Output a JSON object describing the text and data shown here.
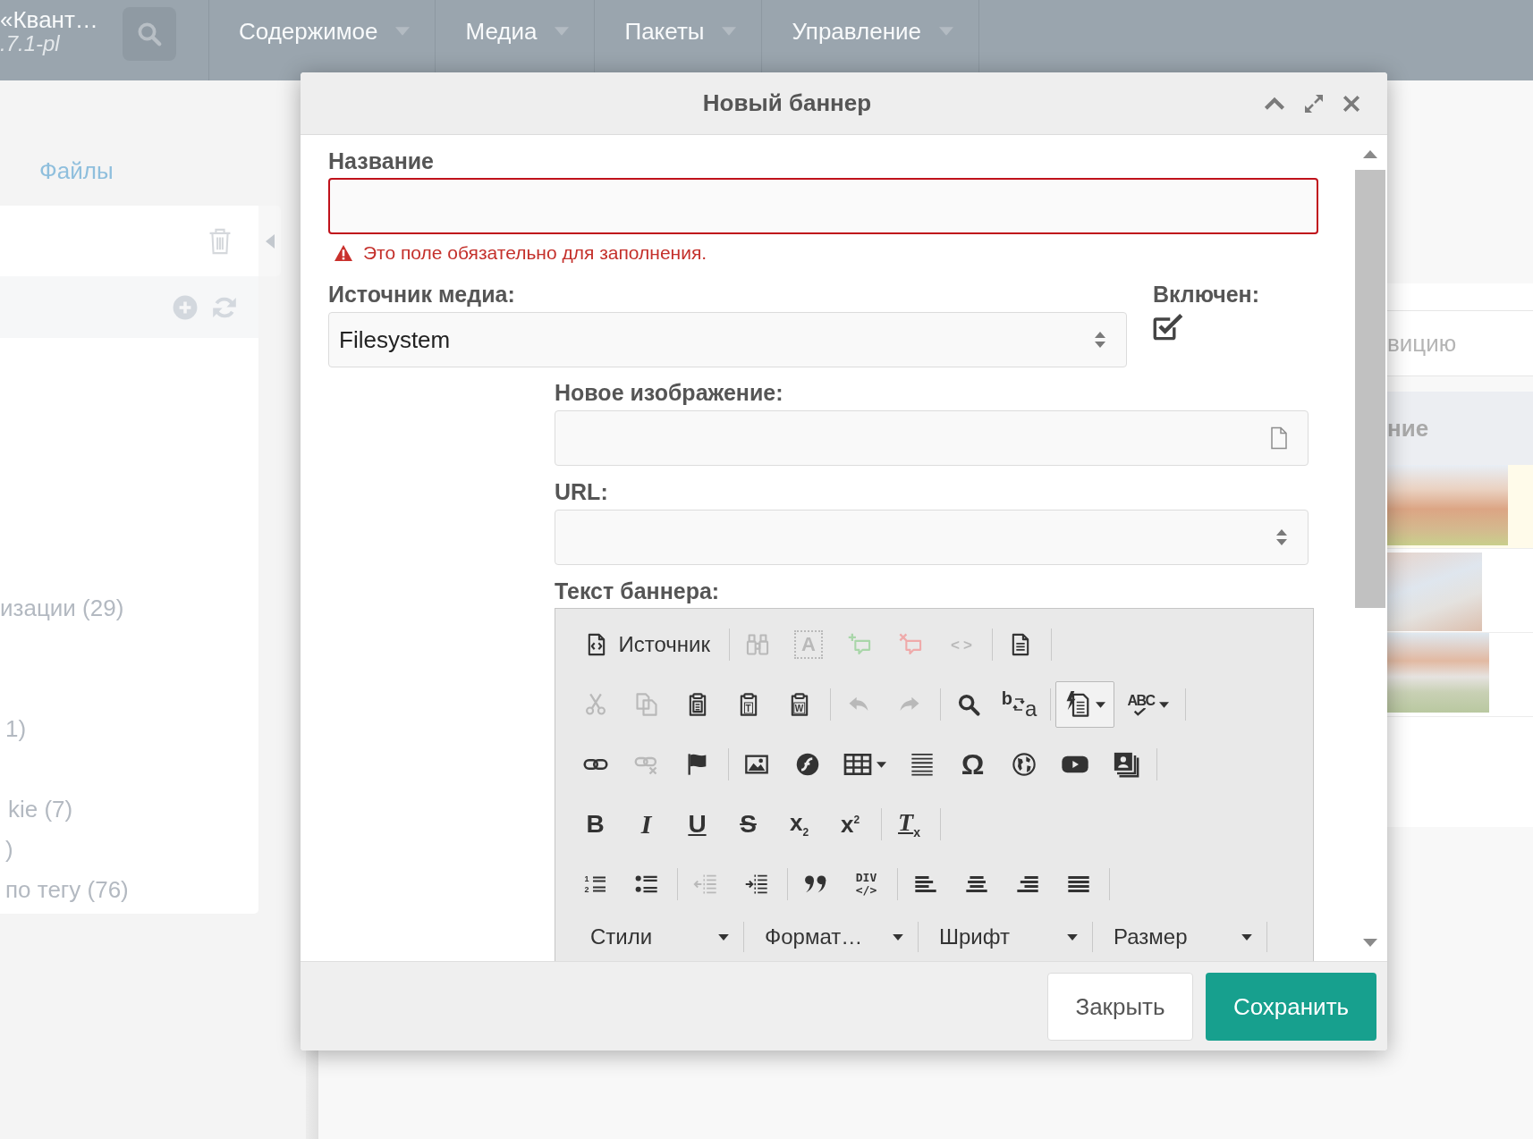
{
  "topbar": {
    "site_name": "«Квант…",
    "version": ".7.1-pl",
    "menu": [
      {
        "label": "Содержимое"
      },
      {
        "label": "Медиа"
      },
      {
        "label": "Пакеты"
      },
      {
        "label": "Управление"
      }
    ]
  },
  "sidebar": {
    "tab": "Файлы",
    "items": [
      {
        "label": "изации (29)"
      },
      {
        "label": "1)"
      },
      {
        "label": "kie (7)"
      },
      {
        "label": ")"
      },
      {
        "label": "по тегу (76)"
      }
    ]
  },
  "right_panel": {
    "row_text": "вицию",
    "heading": "ние",
    "image_rows": [
      {
        "highlighted": true
      },
      {
        "highlighted": false
      },
      {
        "highlighted": false
      }
    ]
  },
  "dialog": {
    "title": "Новый баннер",
    "name_field": {
      "label": "Название",
      "invalid": true,
      "error": "Это поле обязательно для заполнения."
    },
    "media_source": {
      "label": "Источник медиа:",
      "value": "Filesystem"
    },
    "enabled": {
      "label": "Включен:",
      "checked": true
    },
    "image_field": {
      "label": "Новое изображение:"
    },
    "url_field": {
      "label": "URL:"
    },
    "editor": {
      "label": "Текст баннера:",
      "toolbar": [
        [
          [
            {
              "label": "Источник",
              "disabled": false,
              "active": false
            }
          ],
          [
            {
              "disabled": true,
              "active": false
            },
            {
              "glyphs": [
                "A"
              ],
              "disabled": true,
              "active": false
            },
            {
              "disabled": true,
              "active": false
            },
            {
              "disabled": true,
              "active": false
            },
            {
              "glyphs": [
                "<>"
              ],
              "disabled": true,
              "active": false
            }
          ],
          [
            {
              "disabled": false,
              "active": false
            }
          ]
        ],
        [
          [
            {
              "disabled": true,
              "active": false
            },
            {
              "disabled": true,
              "active": false
            },
            {
              "disabled": false,
              "active": false
            },
            {
              "glyphs": [
                "T"
              ],
              "disabled": false,
              "active": false
            },
            {
              "glyphs": [
                "W"
              ],
              "disabled": false,
              "active": false
            }
          ],
          [
            {
              "disabled": true,
              "active": false
            },
            {
              "disabled": true,
              "active": false
            }
          ],
          [
            {
              "disabled": false,
              "active": false
            },
            {
              "glyphs": [
                "b",
                "a"
              ],
              "disabled": false,
              "active": false
            }
          ],
          [
            {
              "disabled": false,
              "active": true
            },
            {
              "glyphs": [
                "ABC"
              ],
              "disabled": false,
              "active": false
            }
          ]
        ],
        [
          [
            {
              "disabled": false,
              "active": false
            },
            {
              "disabled": true,
              "active": false
            },
            {
              "disabled": false,
              "active": false
            }
          ],
          [
            {
              "disabled": false,
              "active": false
            },
            {
              "disabled": false,
              "active": false
            },
            {
              "disabled": false,
              "active": false
            },
            {
              "disabled": false,
              "active": false
            },
            {
              "glyphs": [
                "Ω"
              ],
              "disabled": false,
              "active": false
            },
            {
              "disabled": false,
              "active": false
            },
            {
              "disabled": false,
              "active": false
            },
            {
              "disabled": false,
              "active": false
            }
          ]
        ],
        [
          [
            {
              "glyphs": [
                "B"
              ],
              "disabled": false,
              "active": false
            },
            {
              "glyphs": [
                "I"
              ],
              "disabled": false,
              "active": false
            },
            {
              "glyphs": [
                "U"
              ],
              "disabled": false,
              "active": false
            },
            {
              "glyphs": [
                "S"
              ],
              "disabled": false,
              "active": false
            },
            {
              "glyphs": [
                "x$_{2}$"
              ],
              "disabled": false,
              "active": false
            },
            {
              "glyphs": [
                "x$^{2}$"
              ],
              "disabled": false,
              "active": false
            }
          ],
          [
            {
              "glyphs": [
                "T$_{x}$"
              ],
              "disabled": false,
              "active": false
            }
          ]
        ],
        [
          [
            {
              "glyphs": [
                "1",
                "2"
              ],
              "disabled": false,
              "active": false
            },
            {
              "disabled": false,
              "active": false
            }
          ],
          [
            {
              "disabled": true,
              "active": false
            },
            {
              "disabled": false,
              "active": false
            }
          ],
          [
            {
              "disabled": false,
              "active": false
            },
            {
              "glyphs": [
                "DIV",
                "</>"
              ],
              "disabled": false,
              "active": false
            }
          ],
          [
            {
              "disabled": false,
              "active": false
            },
            {
              "disabled": false,
              "active": false
            },
            {
              "disabled": false,
              "active": false
            },
            {
              "disabled": false,
              "active": false
            }
          ]
        ]
      ],
      "combos": [
        {
          "label": "Стили"
        },
        {
          "label": "Формат…"
        },
        {
          "label": "Шрифт"
        },
        {
          "label": "Размер"
        }
      ]
    },
    "buttons": [
      {
        "label": "Закрыть",
        "kind": "secondary"
      },
      {
        "label": "Сохранить",
        "kind": "primary"
      }
    ]
  }
}
